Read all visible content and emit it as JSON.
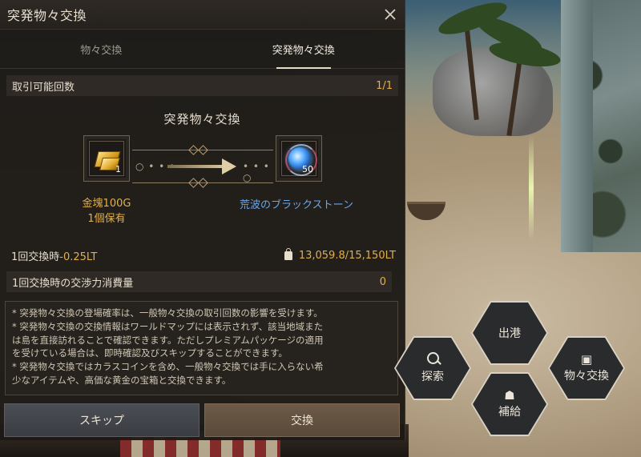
{
  "dialog": {
    "title": "突発物々交換",
    "tabs": [
      {
        "label": "物々交換",
        "active": false
      },
      {
        "label": "突発物々交換",
        "active": true
      }
    ],
    "trade_count_label": "取引可能回数",
    "trade_count_value": "1/1",
    "exchange_title": "突発物々交換",
    "give_item": {
      "name": "金塊100G",
      "qty": "1",
      "owned": "1個保有",
      "icon": "gold-bar-icon"
    },
    "receive_item": {
      "name": "荒波のブラックストーン",
      "qty": "50",
      "icon": "black-stone-icon"
    },
    "weight_label_prefix": "1回交換時",
    "weight_delta": "-0.25LT",
    "weight_value": "13,059.8/15,150LT",
    "energy_cost_label": "1回交換時の交渉力消費量",
    "energy_cost_value": "0",
    "notes": [
      "* 突発物々交換の登場確率は、一般物々交換の取引回数の影響を受けます。",
      "* 突発物々交換の交換情報はワールドマップには表示されず、該当地域また",
      "は島を直接訪れることで確認できます。ただしプレミアムパッケージの適用",
      "を受けている場合は、即時確認及びスキップすることができます。",
      "* 突発物々交換ではカラスコインを含め、一般物々交換では手に入らない希",
      "少なアイテムや、高価な黄金の宝箱と交換できます。"
    ],
    "skip_label": "スキップ",
    "exchange_label": "交換"
  },
  "actions": {
    "depart_label": "出港",
    "explore_label": "探索",
    "barter_label": "物々交換",
    "supply_label": "補給"
  },
  "colors": {
    "accent_gold": "#e2b04a",
    "item_blue": "#6aa6e8",
    "panel_bg": "#1c1916"
  }
}
